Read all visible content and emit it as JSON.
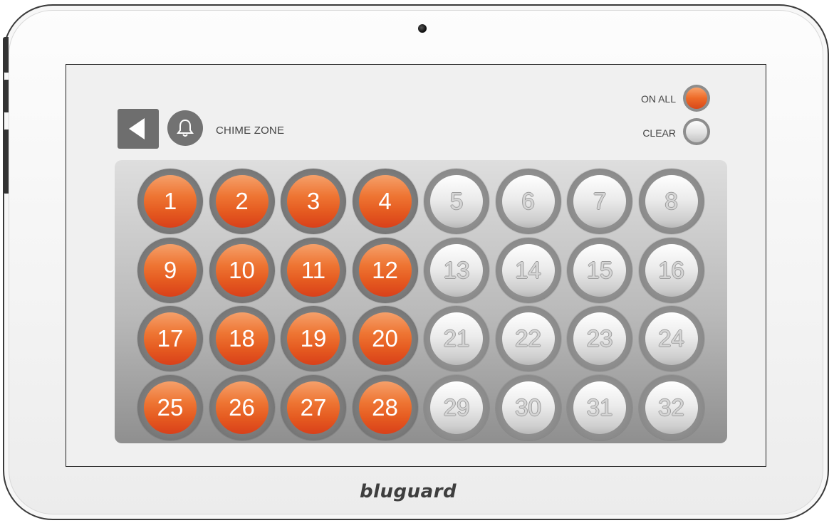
{
  "header": {
    "title": "CHIME ZONE",
    "back_icon": "back-arrow-icon",
    "bell_icon": "bell-icon"
  },
  "controls": {
    "on_all_label": "ON ALL",
    "clear_label": "CLEAR"
  },
  "zones": [
    {
      "label": "1",
      "active": true
    },
    {
      "label": "2",
      "active": true
    },
    {
      "label": "3",
      "active": true
    },
    {
      "label": "4",
      "active": true
    },
    {
      "label": "5",
      "active": false
    },
    {
      "label": "6",
      "active": false
    },
    {
      "label": "7",
      "active": false
    },
    {
      "label": "8",
      "active": false
    },
    {
      "label": "9",
      "active": true
    },
    {
      "label": "10",
      "active": true
    },
    {
      "label": "11",
      "active": true
    },
    {
      "label": "12",
      "active": true
    },
    {
      "label": "13",
      "active": false
    },
    {
      "label": "14",
      "active": false
    },
    {
      "label": "15",
      "active": false
    },
    {
      "label": "16",
      "active": false
    },
    {
      "label": "17",
      "active": true
    },
    {
      "label": "18",
      "active": true
    },
    {
      "label": "19",
      "active": true
    },
    {
      "label": "20",
      "active": true
    },
    {
      "label": "21",
      "active": false
    },
    {
      "label": "22",
      "active": false
    },
    {
      "label": "23",
      "active": false
    },
    {
      "label": "24",
      "active": false
    },
    {
      "label": "25",
      "active": true
    },
    {
      "label": "26",
      "active": true
    },
    {
      "label": "27",
      "active": true
    },
    {
      "label": "28",
      "active": true
    },
    {
      "label": "29",
      "active": false
    },
    {
      "label": "30",
      "active": false
    },
    {
      "label": "31",
      "active": false
    },
    {
      "label": "32",
      "active": false
    }
  ],
  "colors": {
    "active": "#ee6a28",
    "inactive": "#e2e2e2"
  },
  "brand": "bluguard"
}
